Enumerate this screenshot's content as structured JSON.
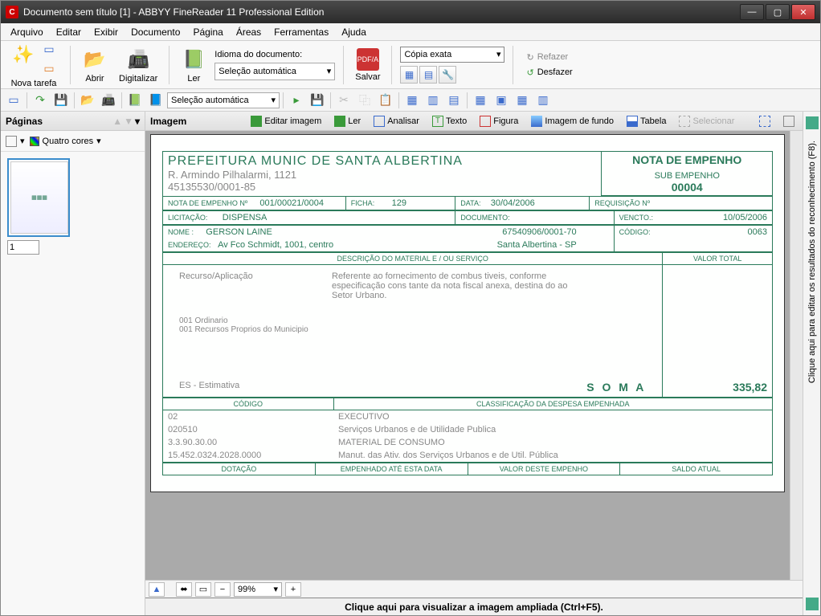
{
  "title": "Documento sem título [1] - ABBYY FineReader 11 Professional Edition",
  "menu": [
    "Arquivo",
    "Editar",
    "Exibir",
    "Documento",
    "Página",
    "Áreas",
    "Ferramentas",
    "Ajuda"
  ],
  "toolbar": {
    "nova_tarefa": "Nova tarefa",
    "abrir": "Abrir",
    "digitalizar": "Digitalizar",
    "ler": "Ler",
    "idioma_lbl": "Idioma do documento:",
    "idioma_sel": "Seleção automática",
    "salvar": "Salvar",
    "copia_sel": "Cópia exata",
    "refazer": "Refazer",
    "desfazer": "Desfazer"
  },
  "tb2_sel": "Seleção automática",
  "pages_panel": {
    "title": "Páginas",
    "viewmode": "Quatro cores",
    "pagenum": "1"
  },
  "img_panel": {
    "title": "Imagem",
    "btns": {
      "editar": "Editar imagem",
      "ler": "Ler",
      "analisar": "Analisar",
      "texto": "Texto",
      "figura": "Figura",
      "fundo": "Imagem de fundo",
      "tabela": "Tabela",
      "selecionar": "Selecionar"
    }
  },
  "zoom": "99%",
  "footer": "Clique aqui para visualizar a imagem ampliada (Ctrl+F5).",
  "right_panel": "Clique aqui para editar os resultados do reconhecimento (F8).",
  "doc": {
    "prefeitura": "PREFEITURA MUNIC DE SANTA ALBERTINA",
    "endereco": "R. Armindo Pilhalarmi, 1121",
    "cnpj": "45135530/0001-85",
    "nota_hdr": "NOTA DE EMPENHO",
    "sub_hdr": "SUB EMPENHO",
    "sub_num": "00004",
    "r1": {
      "nota_lbl": "NOTA DE EMPENHO Nº",
      "nota_v": "001/00021/0004",
      "ficha_lbl": "FICHA:",
      "ficha_v": "129",
      "data_lbl": "DATA:",
      "data_v": "30/04/2006",
      "req_lbl": "REQUISIÇÃO Nº"
    },
    "r2": {
      "lic_lbl": "LICITAÇÃO:",
      "lic_v": "DISPENSA",
      "docu_lbl": "DOCUMENTO:",
      "venc_lbl": "VENCTO.:",
      "venc_v": "10/05/2006"
    },
    "r3": {
      "nome_lbl": "NOME   :",
      "nome_v": "GERSON LAINE",
      "cnpj_v": "67540906/0001-70",
      "cod_lbl": "CÓDIGO:",
      "cod_v": "0063",
      "end_lbl": "ENDEREÇO:",
      "end_v": "Av Fco Schmidt, 1001, centro",
      "cidade": "Santa Albertina - SP"
    },
    "desc_hdr": "DESCRIÇÃO DO MATERIAL E / OU SERVIÇO",
    "valor_hdr": "VALOR TOTAL",
    "recurso": "Recurso/Aplicação",
    "desc": "Referente ao fornecimento de combus tiveis, conforme especificação cons tante da nota fiscal anexa, destina do ao Setor Urbano.",
    "l1": "001     Ordinario",
    "l2": "001     Recursos Proprios do Municipio",
    "est": "ES - Estimativa",
    "soma": "S O M A",
    "soma_v": "335,82",
    "cod_hdr": "CÓDIGO",
    "class_hdr": "CLASSIFICAÇÃO DA DESPESA EMPENHADA",
    "c1": "02",
    "c1v": "EXECUTIVO",
    "c2": "020510",
    "c2v": "Serviços Urbanos e de Utilidade Publica",
    "c3": "3.3.90.30.00",
    "c3v": "MATERIAL DE CONSUMO",
    "c4": "15.452.0324.2028.0000",
    "c4v": "Manut. das Ativ. dos Serviços Urbanos e de Util. Pública",
    "dot": "DOTAÇÃO",
    "emp": "EMPENHADO ATÉ ESTA DATA",
    "vde": "VALOR DESTE EMPENHO",
    "sa": "SALDO ATUAL"
  }
}
